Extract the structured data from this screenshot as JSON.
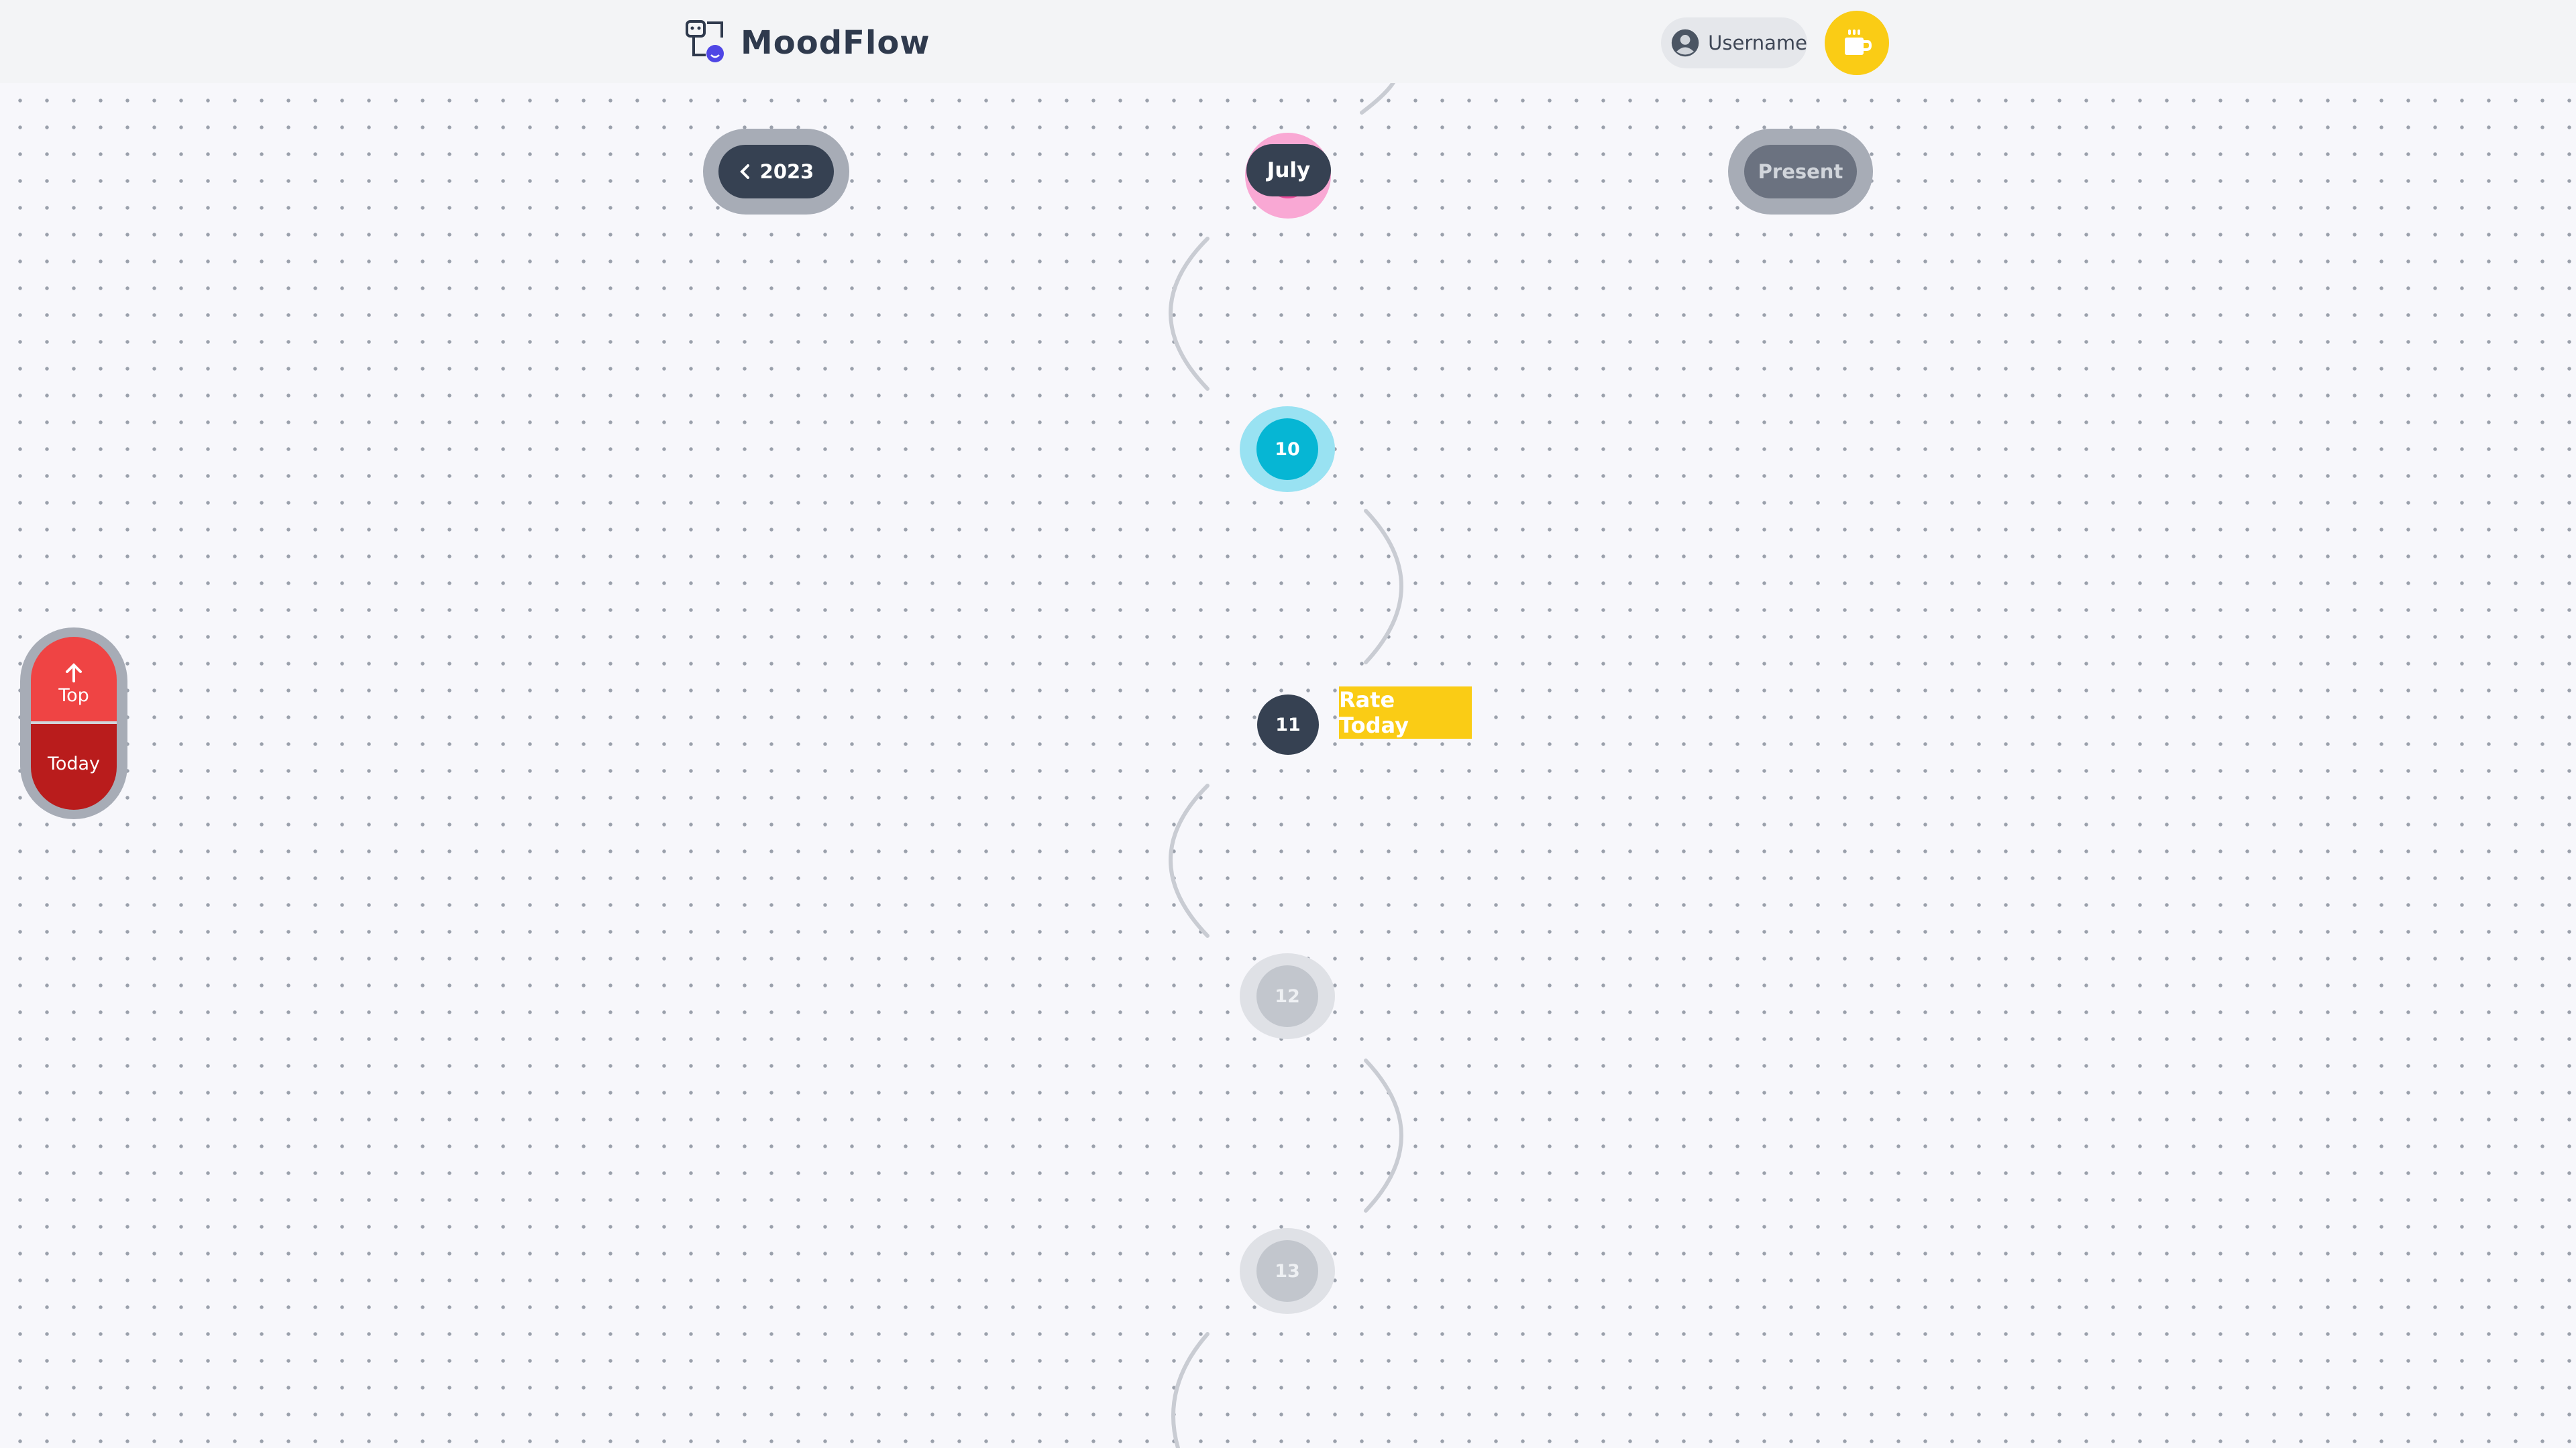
{
  "app": {
    "name": "MoodFlow"
  },
  "header": {
    "username": "Username"
  },
  "nav": {
    "prev_year": "2023",
    "current_month": "July",
    "present": "Present"
  },
  "days": [
    {
      "label": "10",
      "state": "rated",
      "color": "#06b6d4"
    },
    {
      "label": "11",
      "state": "today"
    },
    {
      "label": "12",
      "state": "future"
    },
    {
      "label": "13",
      "state": "future"
    }
  ],
  "rate_today": "Rate Today",
  "side_nav": {
    "top_label": "Top",
    "today_label": "Today"
  },
  "colors": {
    "accent_yellow": "#facc15",
    "dark_slate": "#364152",
    "red": "#ef4444",
    "dark_red": "#b91c1c",
    "mood_cyan": "#06b6d4",
    "month_pink": "#f9a8d4"
  }
}
